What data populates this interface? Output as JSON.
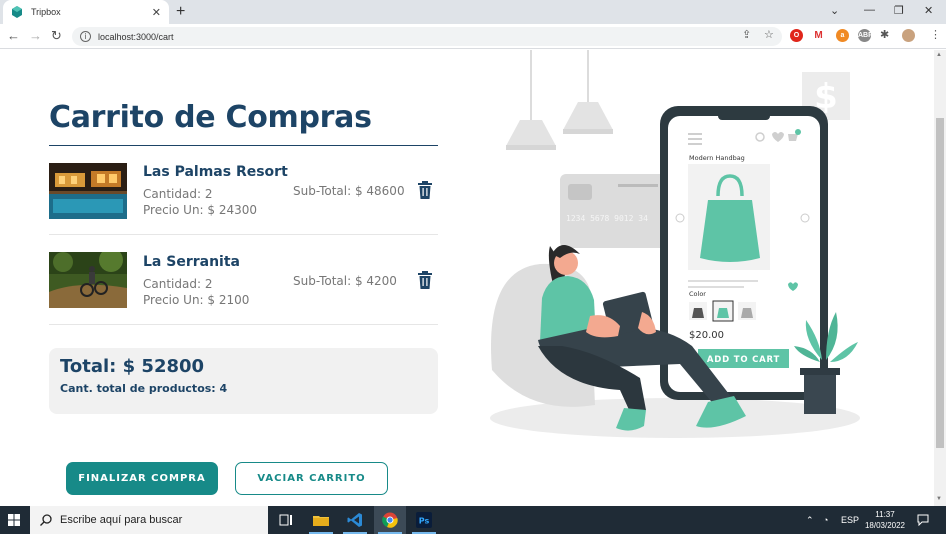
{
  "browser": {
    "tab_title": "Tripbox",
    "url": "localhost:3000/cart",
    "icons": [
      "back-icon",
      "forward-icon",
      "reload-icon",
      "share-icon",
      "bookmark-star-icon",
      "extensions-icon",
      "menu-icon"
    ]
  },
  "page": {
    "title": "Carrito de Compras",
    "items": [
      {
        "name": "Las Palmas Resort",
        "qty": "Cantidad: 2",
        "price": "Precio Un: $ 24300",
        "subtotal": "Sub-Total: $ 48600"
      },
      {
        "name": "La Serranita",
        "qty": "Cantidad: 2",
        "price": "Precio Un: $ 2100",
        "subtotal": "Sub-Total: $ 4200"
      }
    ],
    "total": "Total: $ 52800",
    "total_count": "Cant. total de productos: 4",
    "checkout_label": "FINALIZAR COMPRA",
    "empty_label": "VACIAR CARRITO"
  },
  "illustration": {
    "card_number": "1234 5678 9012 34",
    "product_title": "Modern Handbag",
    "color_label": "Color",
    "price": "$20.00",
    "add_to_cart": "ADD TO CART",
    "cart_badge": "1"
  },
  "taskbar": {
    "search_placeholder": "Escribe aquí para buscar",
    "lang": "ESP",
    "time": "11:37",
    "date": "18/03/2022"
  },
  "colors": {
    "primary": "#178a88",
    "heading": "#1d4466",
    "teal_accent": "#5ec4a6"
  }
}
